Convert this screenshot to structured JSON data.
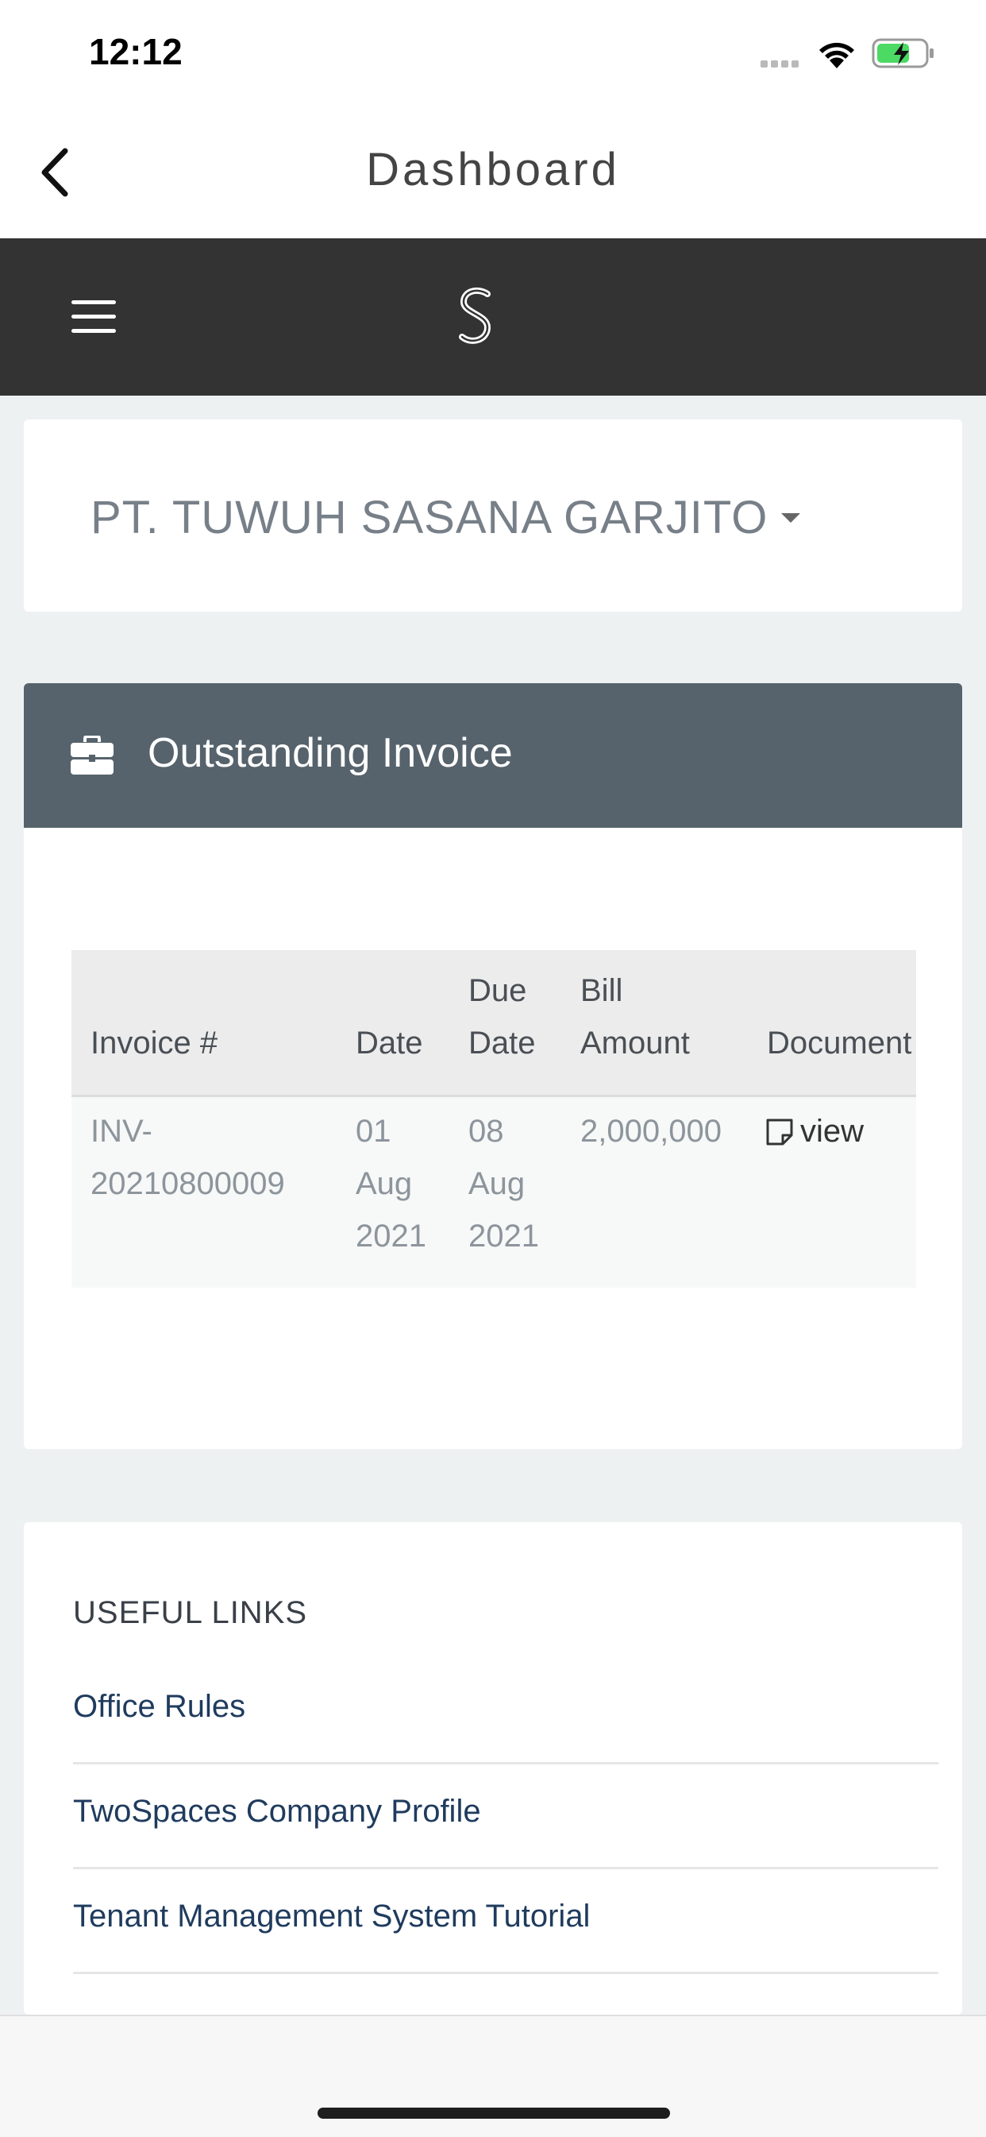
{
  "status_bar": {
    "time": "12:12",
    "icons": [
      "signal-dots-icon",
      "wifi-icon",
      "battery-charging-icon"
    ]
  },
  "nav": {
    "title": "Dashboard",
    "back_icon": "chevron-left-icon"
  },
  "app_bar": {
    "menu_icon": "hamburger-menu-icon",
    "logo_icon": "s-logo-icon",
    "background": "#333333"
  },
  "company": {
    "name": "PT. TUWUH SASANA GARJITO",
    "dropdown_icon": "caret-down-icon"
  },
  "invoice": {
    "title": "Outstanding Invoice",
    "icon": "briefcase-icon",
    "header_color": "#56636c",
    "columns": [
      {
        "line1": "",
        "line2": "Invoice #"
      },
      {
        "line1": "",
        "line2": "Date"
      },
      {
        "line1": "Due",
        "line2": "Date"
      },
      {
        "line1": "Bill",
        "line2": "Amount"
      },
      {
        "line1": "",
        "line2": "Document"
      }
    ],
    "rows": [
      {
        "invoice_no": [
          "INV-",
          "20210800009"
        ],
        "date": [
          "01",
          "Aug",
          "2021"
        ],
        "due_date": [
          "08",
          "Aug",
          "2021"
        ],
        "amount": "2,000,000",
        "document": "view",
        "document_icon": "note-icon"
      }
    ]
  },
  "useful_links": {
    "title": "USEFUL LINKS",
    "items": [
      "Office Rules",
      "TwoSpaces Company Profile",
      "Tenant Management System Tutorial"
    ],
    "link_color": "#1f3b5e"
  }
}
